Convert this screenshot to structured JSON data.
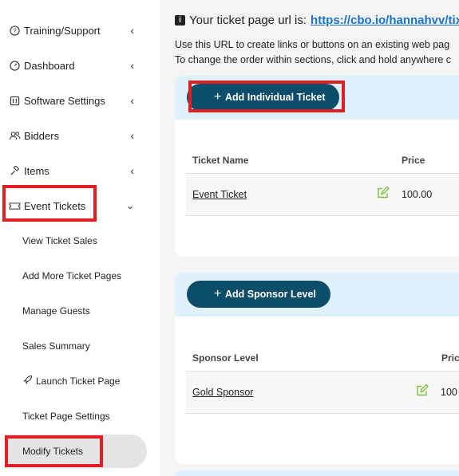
{
  "sidebar": {
    "items": [
      {
        "label": "Training/Support",
        "icon": "question-circle-icon"
      },
      {
        "label": "Dashboard",
        "icon": "gauge-icon"
      },
      {
        "label": "Software Settings",
        "icon": "settings-panel-icon"
      },
      {
        "label": "Bidders",
        "icon": "users-icon"
      },
      {
        "label": "Items",
        "icon": "gavel-icon"
      },
      {
        "label": "Event Tickets",
        "icon": "ticket-icon"
      }
    ],
    "subitems": [
      {
        "label": "View Ticket Sales"
      },
      {
        "label": "Add More Ticket Pages"
      },
      {
        "label": "Manage Guests"
      },
      {
        "label": "Sales Summary"
      },
      {
        "label": "Launch Ticket Page",
        "icon": "rocket-icon"
      },
      {
        "label": "Ticket Page Settings"
      },
      {
        "label": "Modify Tickets"
      }
    ]
  },
  "main": {
    "url_prefix": "Your ticket page url is:",
    "url": "https://cbo.io/hannahvv/tix",
    "help_line1": "Use this URL to create links or buttons on an existing web pag",
    "help_line2": "To change the order within sections, click and hold anywhere c",
    "tickets_card": {
      "button": "Add Individual Ticket",
      "col_name": "Ticket Name",
      "col_price": "Price",
      "rows": [
        {
          "name": "Event Ticket",
          "price": "100.00"
        }
      ]
    },
    "sponsor_card": {
      "button": "Add Sponsor Level",
      "col_name": "Sponsor Level",
      "col_price": "Pric",
      "rows": [
        {
          "name": "Gold Sponsor",
          "price": "100"
        }
      ]
    }
  },
  "colors": {
    "accent": "#0c4d6a",
    "highlight_red": "#e01e24",
    "link": "#1a73c8",
    "card_header": "#dff1fb",
    "edit_green": "#7cc242"
  }
}
